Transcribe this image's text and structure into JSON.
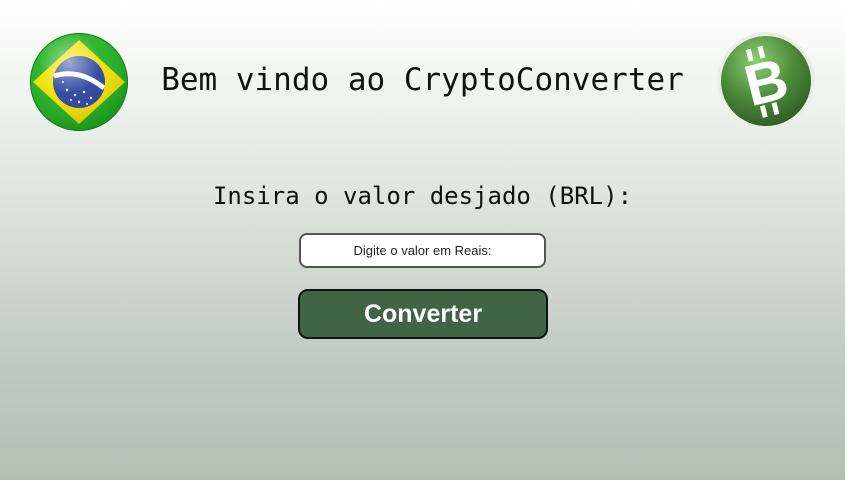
{
  "header": {
    "title": "Bem vindo ao CryptoConverter",
    "left_icon": "brazil-flag-icon",
    "right_icon": "bitcoin-cash-icon"
  },
  "form": {
    "prompt": "Insira o valor desjado (BRL):",
    "amount_input": {
      "value": "",
      "placeholder": "Digite o valor em Reais:"
    },
    "convert_label": "Converter"
  },
  "colors": {
    "button_bg": "#416446",
    "bitcoin_green": "#4c8a3a",
    "flag_green": "#20b020",
    "flag_yellow": "#f5e400",
    "flag_blue": "#2a3f9a"
  }
}
